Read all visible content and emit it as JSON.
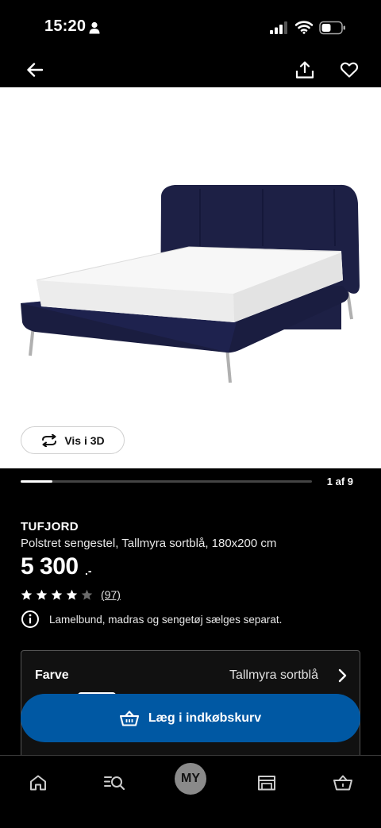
{
  "status_bar": {
    "time": "15:20",
    "icons": [
      "person-icon",
      "signal-icon",
      "wifi-icon",
      "battery-icon"
    ]
  },
  "app_bar": {
    "icons": [
      "arrow-left-icon",
      "share-icon",
      "heart-icon"
    ]
  },
  "hero": {
    "view_3d_label": "Vis i 3D",
    "view_3d_icon": "rotate-3d-icon"
  },
  "gallery": {
    "counter": "1 af 9",
    "progress_fraction": 0.11
  },
  "product": {
    "name": "TUFJORD",
    "description": "Polstret sengestel, Tallmyra sortblå, 180x200 cm",
    "price": "5 300",
    "price_suffix": ".-",
    "rating": 4,
    "rating_max": 5,
    "review_count": "(97)",
    "notice": "Lamelbund, madras og sengetøj sælges separat.",
    "notice_icon": "info-icon"
  },
  "color_selector": {
    "label": "Farve",
    "value": "Tallmyra sortblå",
    "swatch_color": "#1a1f3a"
  },
  "cta": {
    "label": "Læg i indkøbskurv",
    "icon": "basket-icon",
    "color": "#0058a3"
  },
  "bottom_nav": {
    "my_label": "MY",
    "icons": [
      "home-icon",
      "search-list-icon",
      "store-icon",
      "cart-icon"
    ]
  }
}
